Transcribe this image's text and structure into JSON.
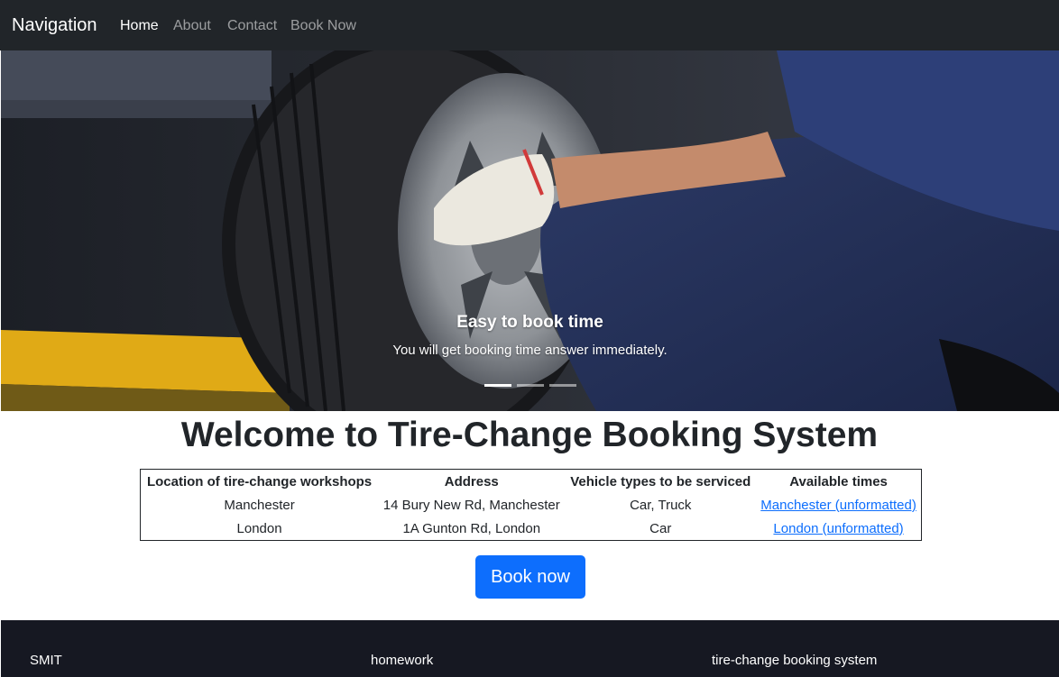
{
  "navbar": {
    "brand": "Navigation",
    "links": [
      {
        "label": "Home",
        "active": true
      },
      {
        "label": "About",
        "active": false
      },
      {
        "label": "Contact",
        "active": false
      },
      {
        "label": "Book Now",
        "active": false
      }
    ]
  },
  "carousel": {
    "caption_title": "Easy to book time",
    "caption_text": "You will get booking time answer immediately.",
    "slide_count": 3,
    "active_slide": 1
  },
  "main": {
    "heading": "Welcome to Tire-Change Booking System",
    "table": {
      "headers": [
        "Location of tire-change workshops",
        "Address",
        "Vehicle types to be serviced",
        "Available times"
      ],
      "rows": [
        [
          "Manchester",
          "14 Bury New Rd, Manchester",
          "Car, Truck",
          "Manchester (unformatted)"
        ],
        [
          "London",
          "1A Gunton Rd, London",
          "Car",
          "London (unformatted)"
        ]
      ]
    },
    "book_button": "Book now"
  },
  "footer": {
    "items": [
      "SMIT",
      "homework",
      "tire-change booking system"
    ]
  },
  "colors": {
    "navbar_bg": "#212529",
    "primary": "#0d6efd",
    "footer_bg": "#161822"
  }
}
